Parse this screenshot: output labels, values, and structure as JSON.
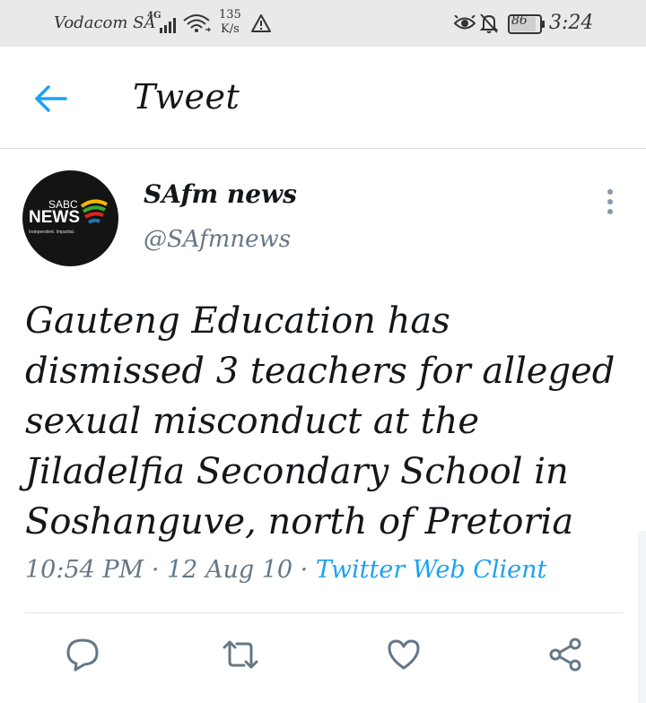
{
  "status_bar": {
    "carrier": "Vodacom SA",
    "network_type": "4G",
    "speed_value": "135",
    "speed_unit": "K/s",
    "battery_level": "86",
    "time": "3:24"
  },
  "header": {
    "title": "Tweet",
    "back_icon": "arrow-left-icon"
  },
  "tweet": {
    "avatar": {
      "brand_top": "SABC",
      "brand_main": "NEWS",
      "tagline": "Independent. Impartial."
    },
    "author_name": "SAfm news",
    "author_handle": "@SAfmnews",
    "text": "Gauteng Education has dismissed 3 teachers for alleged sexual misconduct at the Jiladelfia Secondary School in Soshanguve, north of Pretoria",
    "time": "10:54 PM",
    "separator": "·",
    "date": "12 Aug 10",
    "client": "Twitter Web Client"
  },
  "actions": {
    "reply_icon": "comment-icon",
    "retweet_icon": "retweet-icon",
    "like_icon": "heart-icon",
    "share_icon": "share-icon"
  },
  "colors": {
    "accent": "#1da1f2",
    "secondary_text": "#657786",
    "status_bar_bg": "#e9e9e9"
  }
}
